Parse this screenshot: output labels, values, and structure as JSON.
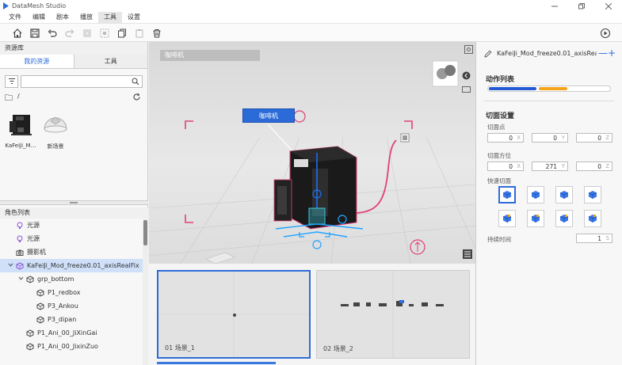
{
  "window": {
    "title": "DataMesh Studio"
  },
  "menu": [
    "文件",
    "编辑",
    "剧本",
    "播放",
    "工具",
    "设置"
  ],
  "active_menu_index": 4,
  "left": {
    "resource_header": "资源库",
    "tabs": [
      "我的资源",
      "工具"
    ],
    "search_placeholder": "",
    "path": "/",
    "assets": [
      {
        "label": "KaFeiJi_M…"
      },
      {
        "label": "新场景"
      }
    ],
    "roles_header": "角色列表",
    "tree": [
      {
        "label": "光源",
        "icon": "light-bulb-icon",
        "indent": 0
      },
      {
        "label": "光源",
        "icon": "light-bulb-icon",
        "indent": 0
      },
      {
        "label": "摄影机",
        "icon": "camera-icon",
        "indent": 0
      },
      {
        "label": "KaFeiJi_Mod_freeze0.01_axisRealFix",
        "icon": "model-icon",
        "indent": 0,
        "expanded": true,
        "selected": true
      },
      {
        "label": "grp_bottom",
        "icon": "group-icon",
        "indent": 1,
        "expanded": true
      },
      {
        "label": "P1_redbox",
        "icon": "mesh-icon",
        "indent": 2
      },
      {
        "label": "P3_Ankou",
        "icon": "mesh-icon",
        "indent": 2
      },
      {
        "label": "P3_dipan",
        "icon": "mesh-icon",
        "indent": 2
      },
      {
        "label": "P1_Ani_00_JiXinGai",
        "icon": "mesh-icon",
        "indent": 1
      },
      {
        "label": "P1_Ani_00_JixinZuo",
        "icon": "mesh-icon",
        "indent": 1
      }
    ]
  },
  "viewport": {
    "scene_label": "咖啡机",
    "object_tag": "咖啡机"
  },
  "scenes": [
    {
      "label": "01 场景_1",
      "active": true
    },
    {
      "label": "02 场景_2",
      "active": false
    }
  ],
  "right": {
    "title": "KaFeiJi_Mod_freeze0.01_axisRealF…",
    "minus": "—",
    "plus": "+",
    "action_list_title": "动作列表",
    "cut_settings_title": "切面设置",
    "cut_point_label": "切面点",
    "cut_point": [
      {
        "value": "0",
        "axis": "X"
      },
      {
        "value": "0",
        "axis": "Y"
      },
      {
        "value": "0",
        "axis": "Z"
      }
    ],
    "cut_dir_label": "切面方位",
    "cut_dir": [
      {
        "value": "0",
        "axis": "X"
      },
      {
        "value": "271",
        "axis": "Y"
      },
      {
        "value": "0",
        "axis": "Z"
      }
    ],
    "quick_cut_label": "快速切面",
    "duration_label": "持续时间",
    "duration": {
      "value": "1",
      "unit": "S"
    }
  },
  "colors": {
    "accent": "#2f6cd8",
    "action_blue": "#2459d4",
    "action_orange": "#f4a31a",
    "selection_pink": "#e0407a"
  }
}
